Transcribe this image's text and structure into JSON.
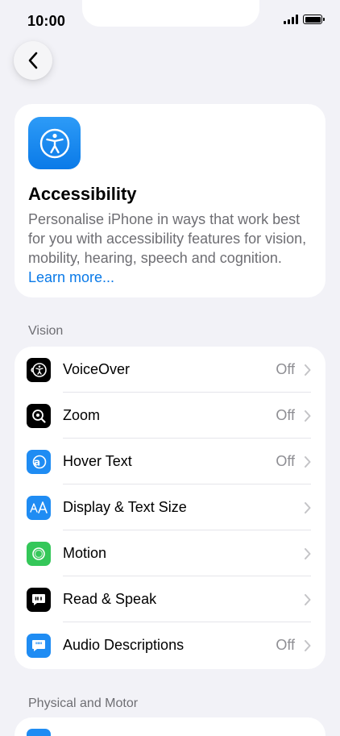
{
  "status_bar": {
    "time": "10:00"
  },
  "hero": {
    "title": "Accessibility",
    "description": "Personalise iPhone in ways that work best for you with accessibility features for vision, mobility, hearing, speech and cognition.",
    "link": "Learn more..."
  },
  "sections": [
    {
      "header": "Vision"
    },
    {
      "header": "Physical and Motor"
    }
  ],
  "vision_items": [
    {
      "label": "VoiceOver",
      "value": "Off",
      "icon": "voiceover-icon",
      "color": "#000000"
    },
    {
      "label": "Zoom",
      "value": "Off",
      "icon": "zoom-icon",
      "color": "#000000"
    },
    {
      "label": "Hover Text",
      "value": "Off",
      "icon": "hover-text-icon",
      "color": "#1f8cf3"
    },
    {
      "label": "Display & Text Size",
      "value": "",
      "icon": "display-text-size-icon",
      "color": "#1f8cf3"
    },
    {
      "label": "Motion",
      "value": "",
      "icon": "motion-icon",
      "color": "#34c759"
    },
    {
      "label": "Read & Speak",
      "value": "",
      "icon": "read-speak-icon",
      "color": "#000000"
    },
    {
      "label": "Audio Descriptions",
      "value": "Off",
      "icon": "audio-descriptions-icon",
      "color": "#1f8cf3"
    }
  ]
}
